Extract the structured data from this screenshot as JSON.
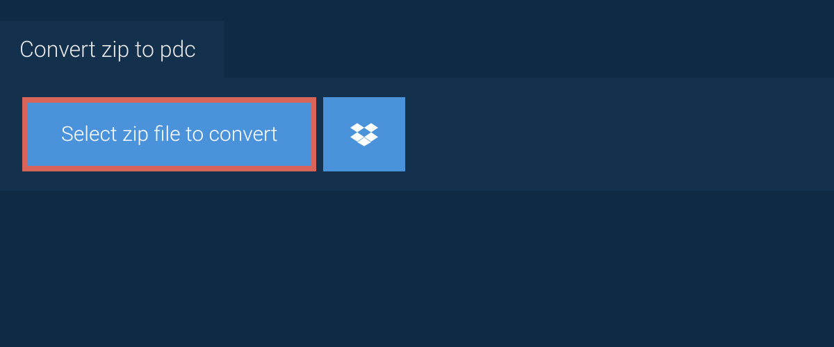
{
  "header": {
    "title": "Convert zip to pdc"
  },
  "actions": {
    "select_label": "Select zip file to convert"
  },
  "colors": {
    "bg": "#0f2a44",
    "panel": "#13304d",
    "button": "#4a92d9",
    "highlight_border": "#d96459",
    "text_light": "#e8e8e8"
  }
}
